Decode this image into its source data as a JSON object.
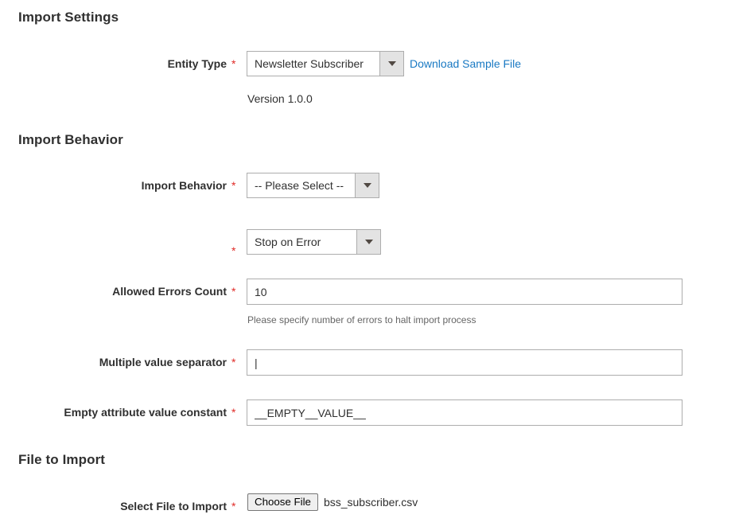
{
  "sections": {
    "import_settings": {
      "title": "Import Settings"
    },
    "import_behavior": {
      "title": "Import Behavior"
    },
    "file_to_import": {
      "title": "File to Import"
    }
  },
  "fields": {
    "entity_type": {
      "label": "Entity Type",
      "required_marker": "*",
      "value": "Newsletter Subscriber",
      "sample_link": "Download Sample File",
      "version_note": "Version 1.0.0"
    },
    "import_behavior": {
      "label": "Import Behavior",
      "required_marker": "*",
      "value": "-- Please Select --"
    },
    "error_handling": {
      "label": "",
      "required_marker": "*",
      "value": "Stop on Error"
    },
    "allowed_errors_count": {
      "label": "Allowed Errors Count",
      "required_marker": "*",
      "value": "10",
      "note": "Please specify number of errors to halt import process"
    },
    "multiple_value_separator": {
      "label": "Multiple value separator",
      "required_marker": "*",
      "value": "|"
    },
    "empty_attribute_value_constant": {
      "label": "Empty attribute value constant",
      "required_marker": "*",
      "value": "__EMPTY__VALUE__"
    },
    "select_file_to_import": {
      "label": "Select File to Import",
      "required_marker": "*",
      "button_label": "Choose File",
      "file_name": "bss_subscriber.csv"
    }
  },
  "colors": {
    "link": "#1979c3",
    "required": "#e02b27",
    "text": "#303030",
    "note": "#666666",
    "border": "#adadad"
  }
}
